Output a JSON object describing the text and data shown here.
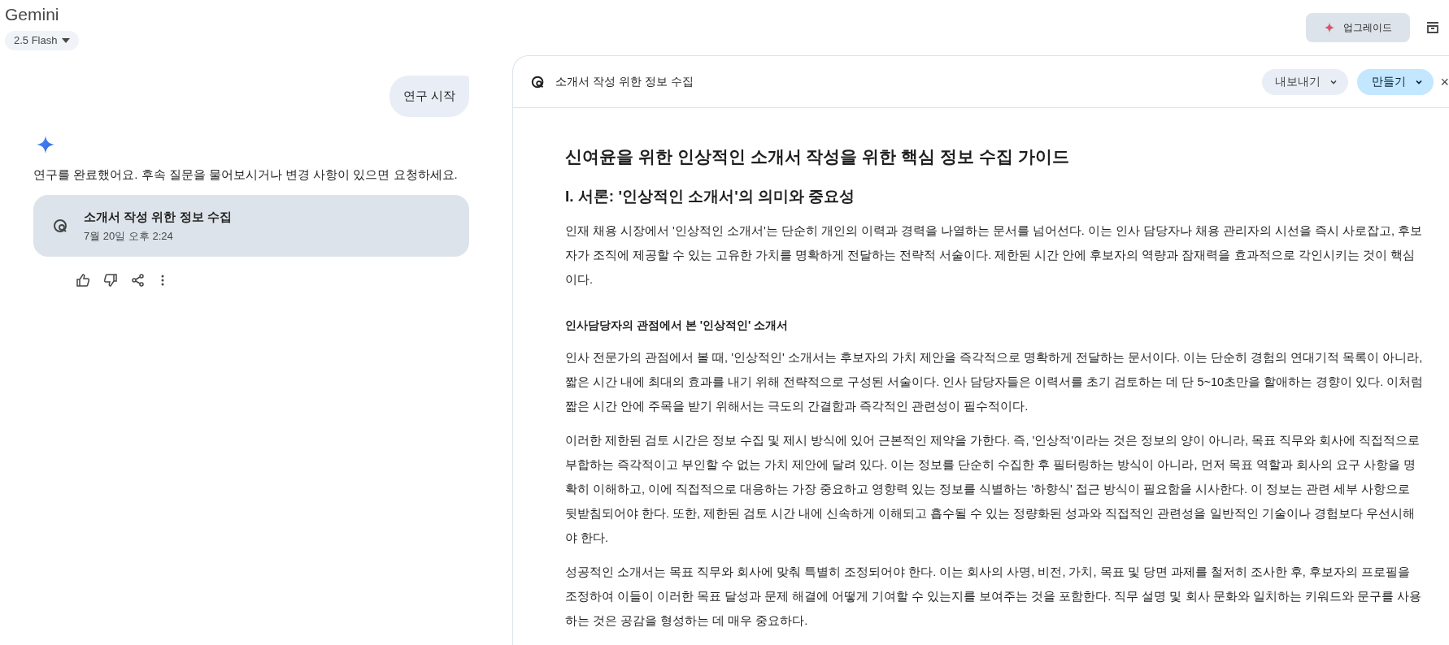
{
  "header": {
    "title": "Gemini",
    "model": "2.5 Flash",
    "upgrade": "업그레이드"
  },
  "chat": {
    "user_message": "연구 시작",
    "response": "연구를 완료했어요. 후속 질문을 물어보시거나 변경 사항이 있으면 요청하세요.",
    "research_card": {
      "title": "소개서 작성 위한 정보 수집",
      "time": "7월 20일 오후 2:24"
    }
  },
  "canvas": {
    "title": "소개서 작성 위한 정보 수집",
    "export": "내보내기",
    "create": "만들기",
    "close": "×",
    "document": {
      "title": "신여윤을 위한 인상적인 소개서 작성을 위한 핵심 정보 수집 가이드",
      "blocks": [
        {
          "kind": "heading",
          "text": "I. 서론: '인상적인 소개서'의 의미와 중요성"
        },
        {
          "kind": "paragraph",
          "text": "인재 채용 시장에서 '인상적인 소개서'는 단순히 개인의 이력과 경력을 나열하는 문서를 넘어선다. 이는 인사 담당자나 채용 관리자의 시선을 즉시 사로잡고, 후보자가 조직에 제공할 수 있는 고유한 가치를 명확하게 전달하는 전략적 서술이다. 제한된 시간 안에 후보자의 역량과 잠재력을 효과적으로 각인시키는 것이 핵심이다."
        },
        {
          "kind": "subheading",
          "text": "인사담당자의 관점에서 본 '인상적인' 소개서"
        },
        {
          "kind": "paragraph",
          "text": "인사 전문가의 관점에서 볼 때, '인상적인' 소개서는 후보자의 가치 제안을 즉각적으로 명확하게 전달하는 문서이다. 이는 단순히 경험의 연대기적 목록이 아니라, 짧은 시간 내에 최대의 효과를 내기 위해 전략적으로 구성된 서술이다. 인사 담당자들은 이력서를 초기 검토하는 데 단 5~10초만을 할애하는 경향이 있다. 이처럼 짧은 시간 안에 주목을 받기 위해서는 극도의 간결함과 즉각적인 관련성이 필수적이다."
        },
        {
          "kind": "paragraph",
          "text": "이러한 제한된 검토 시간은 정보 수집 및 제시 방식에 있어 근본적인 제약을 가한다. 즉, '인상적'이라는 것은 정보의 양이 아니라, 목표 직무와 회사에 직접적으로 부합하는 즉각적이고 부인할 수 없는 가치 제안에 달려 있다. 이는 정보를 단순히 수집한 후 필터링하는 방식이 아니라, 먼저 목표 역할과 회사의 요구 사항을 명확히 이해하고, 이에 직접적으로 대응하는 가장 중요하고 영향력 있는 정보를 식별하는 '하향식' 접근 방식이 필요함을 시사한다. 이 정보는 관련 세부 사항으로 뒷받침되어야 한다. 또한, 제한된 검토 시간 내에 신속하게 이해되고 흡수될 수 있는 정량화된 성과와 직접적인 관련성을 일반적인 기술이나 경험보다 우선시해야 한다."
        },
        {
          "kind": "paragraph",
          "text": "성공적인 소개서는 목표 직무와 회사에 맞춰 특별히 조정되어야 한다. 이는 회사의 사명, 비전, 가치, 목표 및 당면 과제를 철저히 조사한 후, 후보자의 프로필을 조정하여 이들이 이러한 목표 달성과 문제 해결에 어떻게 기여할 수 있는지를 보여주는 것을 포함한다. 직무 설명 및 회사 문화와 일치하는 키워드와 문구를 사용하는 것은 공감을 형성하는 데 매우 중요하다."
        }
      ]
    }
  }
}
